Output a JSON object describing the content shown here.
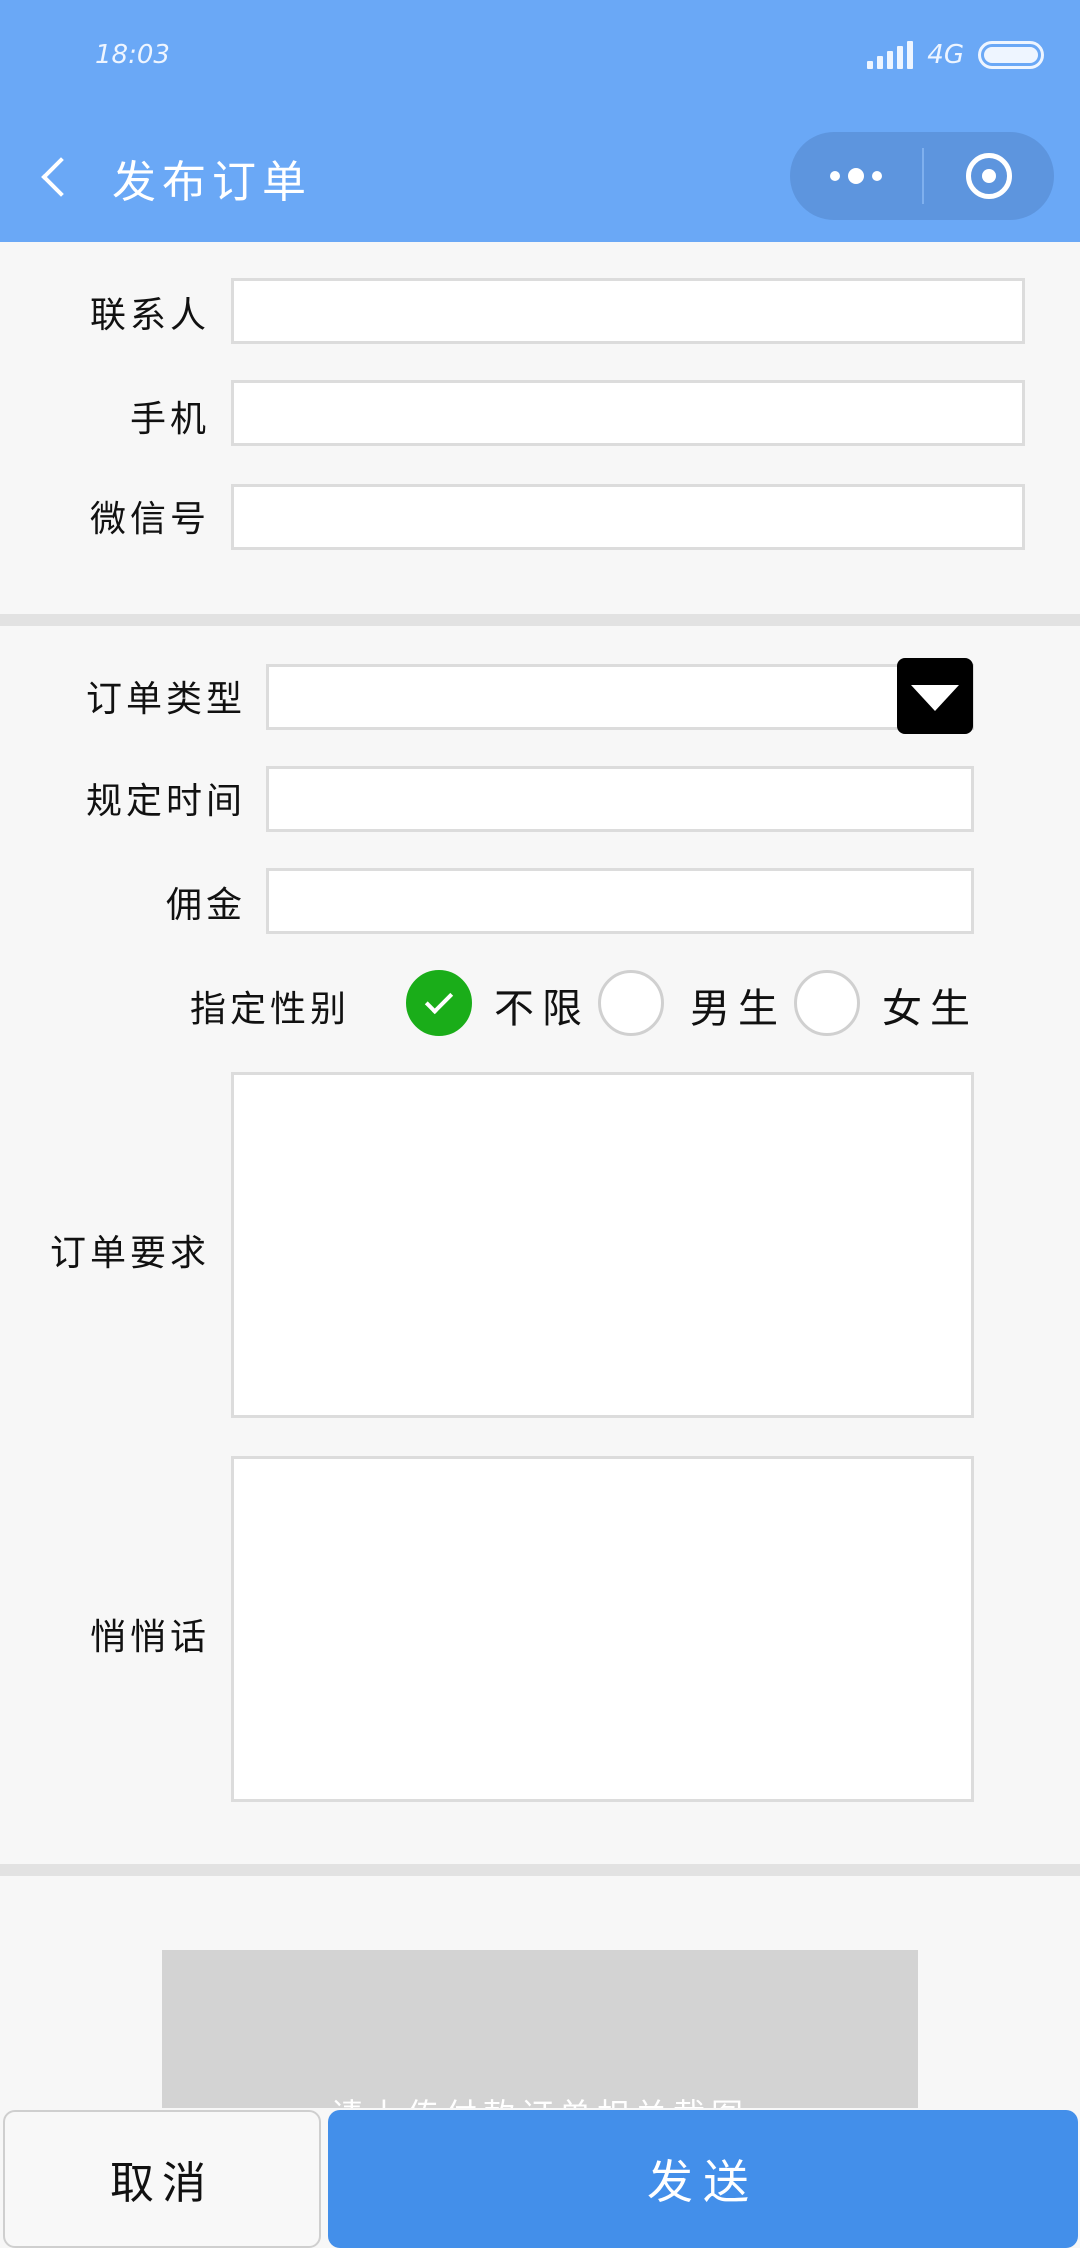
{
  "status_bar": {
    "time": "18:03",
    "network": "4G"
  },
  "header": {
    "title": "发布订单"
  },
  "contact_section": {
    "contact_label": "联系人",
    "phone_label": "手机",
    "wechat_label": "微信号"
  },
  "order_section": {
    "type_label": "订单类型",
    "time_label": "规定时间",
    "commission_label": "佣金",
    "gender_label": "指定性别",
    "gender_options": [
      "不限",
      "男生",
      "女生"
    ],
    "gender_selected": "不限",
    "requirements_label": "订单要求",
    "message_label": "悄悄话"
  },
  "upload": {
    "hint": "请上传付款订单相关截图"
  },
  "actions": {
    "cancel_label": "取消",
    "send_label": "发送"
  },
  "colors": {
    "header_bg": "#6aa8f6",
    "send_button": "#438fea",
    "radio_checked": "#1aad19",
    "page_bg": "#f7f7f7"
  }
}
